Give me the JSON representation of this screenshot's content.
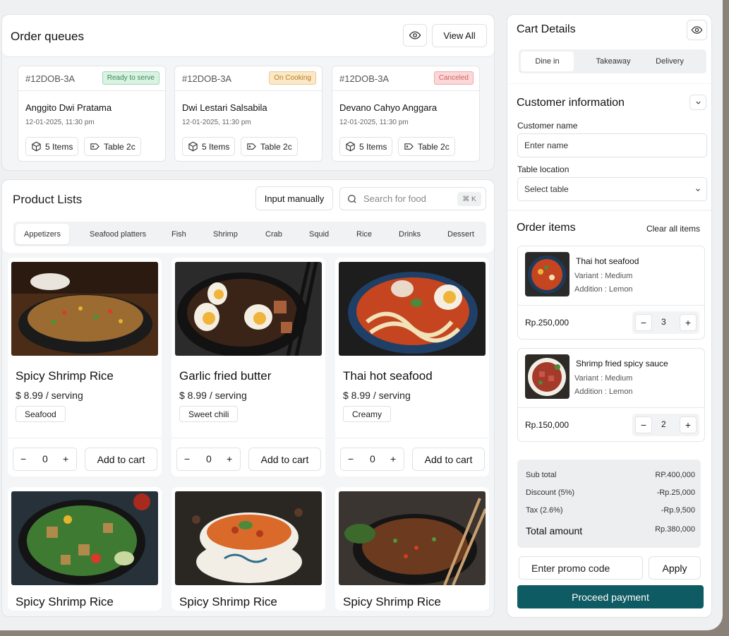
{
  "order_queues": {
    "title": "Order queues",
    "view_all": "View All",
    "orders": [
      {
        "code": "#12DOB-3A",
        "status": "Ready to serve",
        "status_color": "#4caf72",
        "status_bg": "#d9f2e2",
        "customer": "Anggito Dwi Pratama",
        "date": "12-01-2025, 11:30 pm",
        "items": "5 Items",
        "table": "Table 2c"
      },
      {
        "code": "#12DOB-3A",
        "status": "On Cooking",
        "status_color": "#c98a24",
        "status_bg": "#fbe8c8",
        "customer": "Dwi Lestari Salsabila",
        "date": "12-01-2025, 11:30 pm",
        "items": "5 Items",
        "table": "Table 2c"
      },
      {
        "code": "#12DOB-3A",
        "status": "Canceled",
        "status_color": "#d66060",
        "status_bg": "#fad8d8",
        "customer": "Devano Cahyo Anggara",
        "date": "12-01-2025, 11:30 pm",
        "items": "5 Items",
        "table": "Table 2c"
      }
    ]
  },
  "product_lists": {
    "title": "Product Lists",
    "input_manually": "Input manually",
    "search_placeholder": "Search for food",
    "shortcut": "⌘ K",
    "categories": [
      "Appetizers",
      "Seafood platters",
      "Fish",
      "Shrimp",
      "Crab",
      "Squid",
      "Rice",
      "Drinks",
      "Dessert"
    ],
    "active_category": "Appetizers",
    "products": [
      {
        "name": "Spicy Shrimp Rice",
        "price": "$ 8.99 / serving",
        "tag": "Seafood",
        "qty": "0",
        "add": "Add to cart"
      },
      {
        "name": "Garlic fried butter",
        "price": "$ 8.99 / serving",
        "tag": "Sweet chili",
        "qty": "0",
        "add": "Add to cart"
      },
      {
        "name": "Thai hot seafood",
        "price": "$ 8.99 / serving",
        "tag": "Creamy",
        "qty": "0",
        "add": "Add to cart"
      },
      {
        "name": "Spicy Shrimp Rice"
      },
      {
        "name": "Spicy Shrimp Rice"
      },
      {
        "name": "Spicy Shrimp Rice"
      }
    ]
  },
  "cart": {
    "title": "Cart Details",
    "modes": [
      "Dine in",
      "Takeaway",
      "Delivery"
    ],
    "active_mode": "Dine in",
    "customer_title": "Customer information",
    "customer_name_label": "Customer name",
    "customer_name_placeholder": "Enter name",
    "table_label": "Table location",
    "table_placeholder": "Select table",
    "order_items_title": "Order items",
    "clear_all": "Clear all items",
    "items": [
      {
        "name": "Thai hot seafood",
        "variant": "Variant : Medium",
        "addition": "Addition : Lemon",
        "price": "Rp.250,000",
        "qty": "3"
      },
      {
        "name": "Shrimp fried spicy sauce",
        "variant": "Variant : Medium",
        "addition": "Addition : Lemon",
        "price": "Rp.150,000",
        "qty": "2"
      }
    ],
    "summary": {
      "subtotal_label": "Sub total",
      "subtotal": "RP.400,000",
      "discount_label": "Discount (5%)",
      "discount": "-Rp.25,000",
      "tax_label": "Tax (2.6%)",
      "tax": "-Rp.9,500",
      "total_label": "Total amount",
      "total": "Rp.380,000"
    },
    "promo_placeholder": "Enter promo code",
    "apply": "Apply",
    "proceed": "Proceed payment",
    "accent": "#0f5b63"
  }
}
